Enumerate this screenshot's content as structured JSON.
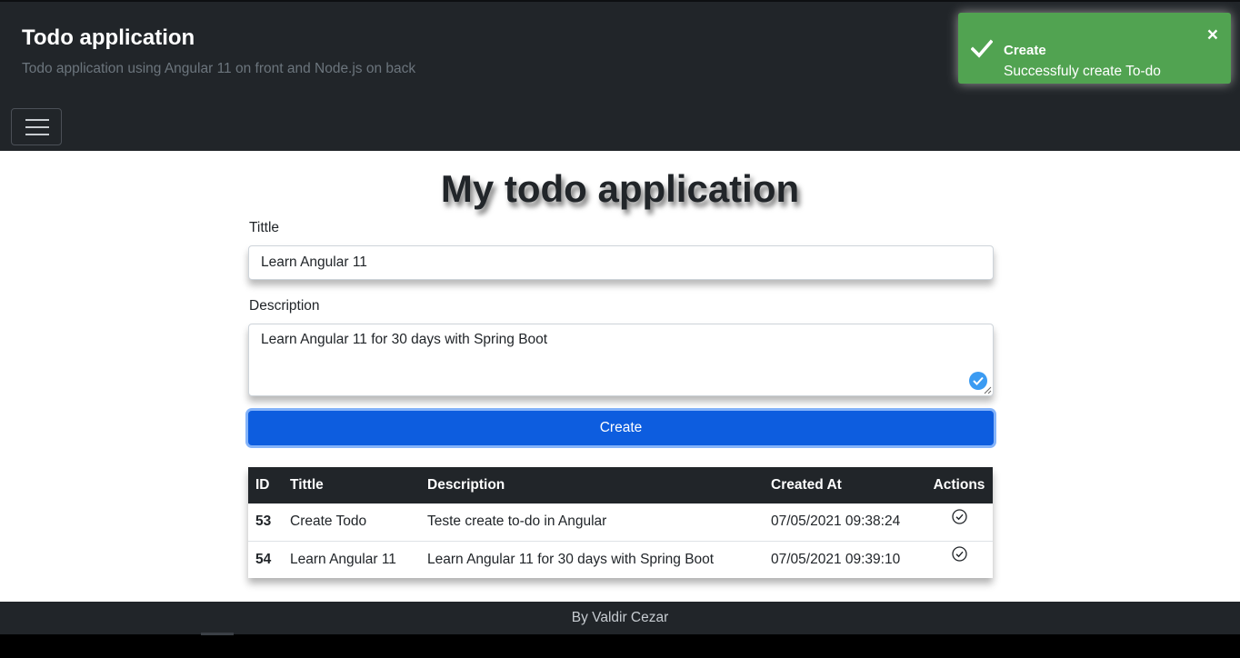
{
  "header": {
    "title": "Todo application",
    "subtitle": "Todo application using Angular 11 on front and Node.js on back"
  },
  "toast": {
    "title": "Create",
    "message": "Successfuly create To-do",
    "close_label": "×",
    "color": "#51a351"
  },
  "main": {
    "page_title": "My todo application",
    "form": {
      "title_label": "Tittle",
      "title_value": "Learn Angular 11",
      "description_label": "Description",
      "description_value": "Learn Angular 11 for 30 days with Spring Boot",
      "create_button": "Create"
    },
    "table": {
      "headers": [
        "ID",
        "Tittle",
        "Description",
        "Created At",
        "Actions"
      ],
      "rows": [
        {
          "id": "53",
          "title": "Create Todo",
          "description": "Teste create to-do in Angular",
          "created_at": "07/05/2021 09:38:24",
          "action_icon": "check-circle-icon"
        },
        {
          "id": "54",
          "title": "Learn Angular 11",
          "description": "Learn Angular 11 for 30 days with Spring Boot",
          "created_at": "07/05/2021 09:39:10",
          "action_icon": "check-circle-icon"
        }
      ]
    }
  },
  "footer": {
    "text": "By Valdir Cezar"
  },
  "colors": {
    "navbar": "#212529",
    "primary": "#0d5ddf",
    "toast_success": "#51a351"
  }
}
